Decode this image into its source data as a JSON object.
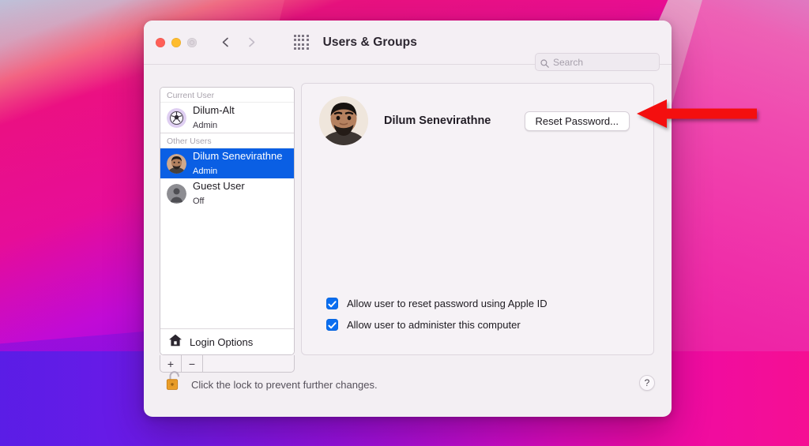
{
  "window": {
    "title": "Users & Groups",
    "traffic_lights": [
      "close-button",
      "minimize-button",
      "zoom-button-disabled"
    ],
    "nav": {
      "back": "back-chevron",
      "forward": "forward-chevron",
      "grid": "all-preferences-grid"
    }
  },
  "search": {
    "placeholder": "Search",
    "value": "",
    "icon": "search-icon"
  },
  "sidebar": {
    "groups": [
      {
        "label": "Current User",
        "users": [
          {
            "name": "Dilum-Alt",
            "role": "Admin",
            "avatar": "soccer-ball-avatar",
            "selected": false
          }
        ]
      },
      {
        "label": "Other Users",
        "users": [
          {
            "name": "Dilum Senevirathne",
            "role": "Admin",
            "avatar": "photo-avatar",
            "selected": true
          },
          {
            "name": "Guest User",
            "role": "Off",
            "avatar": "generic-person-avatar",
            "selected": false
          }
        ]
      }
    ],
    "login_options": {
      "label": "Login Options",
      "icon": "home-icon"
    },
    "footer": {
      "add": "+",
      "remove": "−"
    }
  },
  "account": {
    "name": "Dilum Senevirathne",
    "avatar": "user-photo",
    "reset_password_label": "Reset Password...",
    "options": [
      {
        "label": "Allow user to reset password using Apple ID",
        "checked": true
      },
      {
        "label": "Allow user to administer this computer",
        "checked": true
      }
    ]
  },
  "lock_bar": {
    "icon": "unlocked-padlock-icon",
    "message": "Click the lock to prevent further changes.",
    "help_label": "?"
  },
  "annotation": {
    "arrow": "red-left-arrow",
    "points_to": "reset-password-button"
  },
  "colors": {
    "selection_blue": "#0a5fe4",
    "checkbox_blue": "#0a6ef0",
    "annotation_red": "#f40f0f",
    "lock_gold": "#e8a122",
    "window_bg": "#f3eff3"
  }
}
